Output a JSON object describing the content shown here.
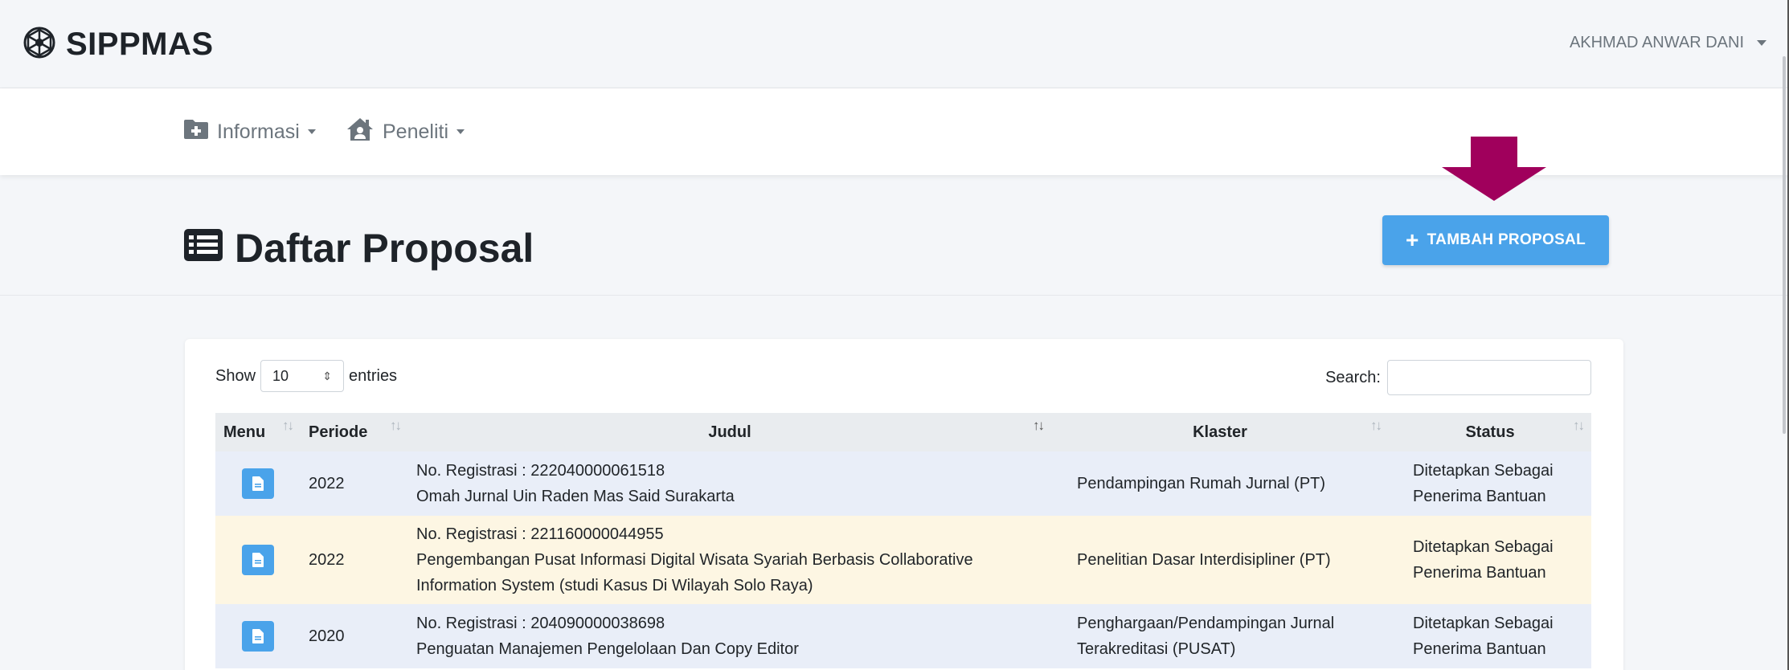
{
  "app": {
    "brand": "SIPPMAS",
    "logo_icon": "dharmachakra-icon"
  },
  "user_menu": {
    "name": "AKHMAD ANWAR DANI",
    "icon": "caret-down-icon"
  },
  "nav": {
    "items": [
      {
        "label": "Informasi",
        "icon": "folder-plus-icon"
      },
      {
        "label": "Peneliti",
        "icon": "house-user-icon"
      }
    ]
  },
  "page": {
    "title": "Daftar Proposal",
    "title_icon": "list-alt-icon",
    "add_button": "TAMBAH PROPOSAL",
    "add_button_icon": "plus-icon"
  },
  "annotation": {
    "arrow_color": "#a0005c"
  },
  "table_controls": {
    "show_label": "Show",
    "entries_value": "10",
    "entries_label": "entries",
    "search_label": "Search:"
  },
  "table": {
    "columns": [
      "Menu",
      "Periode",
      "Judul",
      "Klaster",
      "Status"
    ],
    "rows": [
      {
        "periode": "2022",
        "reg": "No. Registrasi : 222040000061518",
        "title": "Omah Jurnal Uin Raden Mas Said Surakarta",
        "klaster": "Pendampingan Rumah Jurnal (PT)",
        "status": "Ditetapkan Sebagai Penerima Bantuan"
      },
      {
        "periode": "2022",
        "reg": "No. Registrasi : 221160000044955",
        "title": "Pengembangan Pusat Informasi Digital Wisata Syariah Berbasis Collaborative Information System (studi Kasus Di Wilayah Solo Raya)",
        "klaster": "Penelitian Dasar Interdisipliner (PT)",
        "status": "Ditetapkan Sebagai Penerima Bantuan"
      },
      {
        "periode": "2020",
        "reg": "No. Registrasi : 204090000038698",
        "title": "Penguatan Manajemen Pengelolaan Dan Copy Editor",
        "klaster": "Penghargaan/Pendampingan Jurnal Terakreditasi (PUSAT)",
        "status": "Ditetapkan Sebagai Penerima Bantuan"
      }
    ]
  },
  "colors": {
    "primary": "#4aa3ea",
    "row_blue": "#e9eef8",
    "row_yellow": "#fdf6e3"
  }
}
